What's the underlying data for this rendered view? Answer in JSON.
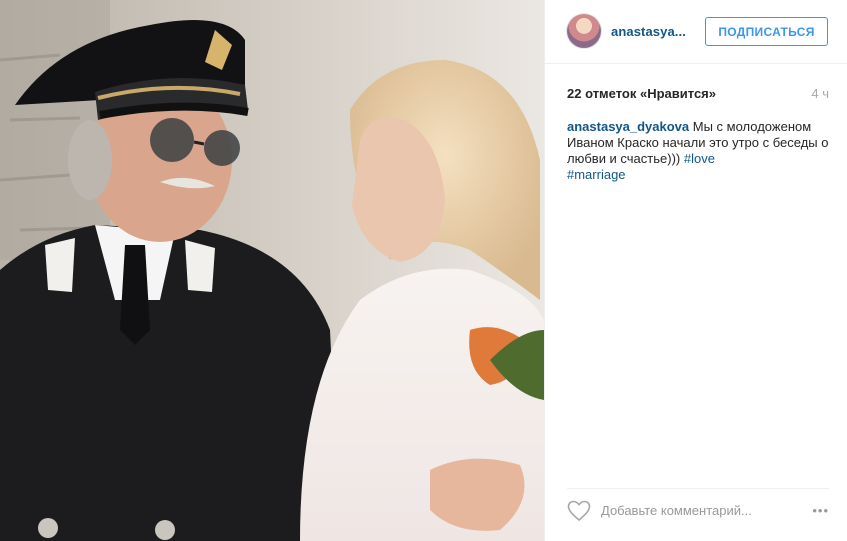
{
  "photo": {
    "alt_description_icon": "photo-image"
  },
  "header": {
    "username": "anastasya...",
    "follow_label": "ПОДПИСАТЬСЯ"
  },
  "stats": {
    "likes": "22 отметок «Нравится»",
    "time": "4 ч"
  },
  "caption": {
    "user": "anastasya_dyakova",
    "text": " Мы с молодоженом Иваном Краско начали это утро с беседы о любви и счастье))) ",
    "tag_1": "#love",
    "tag_2": "#marriage"
  },
  "comment": {
    "placeholder": "Добавьте комментарий...",
    "more_label": "•••"
  },
  "colors": {
    "link_blue": "#125688",
    "button_blue": "#3897f0",
    "muted": "#a5a7aa"
  },
  "icons": {
    "heart": "heart-outline-icon",
    "more": "ellipsis-icon"
  }
}
